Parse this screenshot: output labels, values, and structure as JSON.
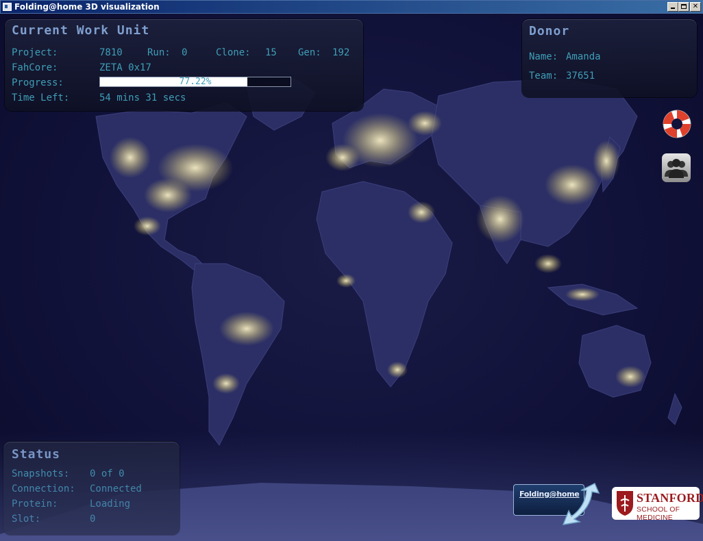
{
  "window": {
    "title": "Folding@home 3D visualization"
  },
  "work_unit": {
    "title": "Current Work Unit",
    "project_label": "Project:",
    "project": "7810",
    "run_label": "Run:",
    "run": "0",
    "clone_label": "Clone:",
    "clone": "15",
    "gen_label": "Gen:",
    "gen": "192",
    "fahcore_label": "FahCore:",
    "fahcore": "ZETA 0x17",
    "progress_label": "Progress:",
    "progress_text": "77.22%",
    "progress_value": 77.22,
    "time_left_label": "Time Left:",
    "time_left": "54 mins 31 secs"
  },
  "donor": {
    "title": "Donor",
    "name_label": "Name:",
    "name": "Amanda",
    "team_label": "Team:",
    "team": "37651"
  },
  "status": {
    "title": "Status",
    "snapshots_label": "Snapshots:",
    "snapshots": "0 of 0",
    "connection_label": "Connection:",
    "connection": "Connected",
    "protein_label": "Protein:",
    "protein": "Loading",
    "slot_label": "Slot:",
    "slot": "0"
  },
  "logos": {
    "folding_at_home": "Folding@home",
    "stanford_name": "STANFORD",
    "stanford_sub": "SCHOOL OF MEDICINE"
  },
  "icons": {
    "help": "lifebuoy-icon",
    "team": "team-people-icon"
  },
  "colors": {
    "panel_text": "#3f9fb8",
    "panel_title": "#7f9fcf",
    "progress_fill": "#ffffff"
  }
}
